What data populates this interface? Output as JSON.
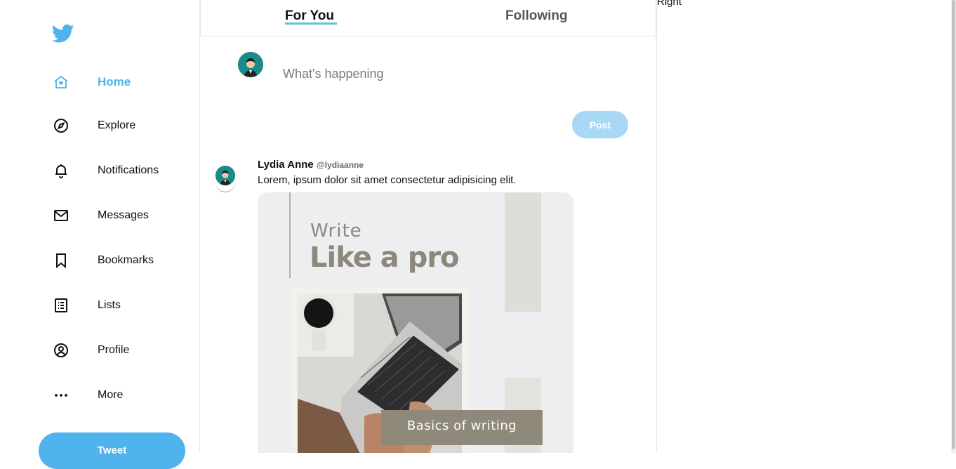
{
  "colors": {
    "brand": "#4fb3ee",
    "active_nav": "#4fb3e8",
    "tab_underline": "#5ec6d6",
    "post_button": "#a8d8f4"
  },
  "sidebar": {
    "logo_icon": "twitter-bird-icon",
    "items": [
      {
        "label": "Home",
        "icon": "home-icon",
        "active": true
      },
      {
        "label": "Explore",
        "icon": "compass-icon"
      },
      {
        "label": "Notifications",
        "icon": "bell-icon"
      },
      {
        "label": "Messages",
        "icon": "envelope-icon"
      },
      {
        "label": "Bookmarks",
        "icon": "bookmark-icon"
      },
      {
        "label": "Lists",
        "icon": "list-icon"
      },
      {
        "label": "Profile",
        "icon": "user-circle-icon"
      },
      {
        "label": "More",
        "icon": "more-dots-icon"
      }
    ],
    "tweet_button": "Tweet"
  },
  "main": {
    "tabs": [
      {
        "label": "For You",
        "active": true
      },
      {
        "label": "Following"
      }
    ],
    "compose": {
      "placeholder": "What's happening",
      "post_button": "Post"
    },
    "tweet": {
      "name": "Lydia Anne",
      "handle": "@lydiaanne",
      "text": "Lorem, ipsum dolor sit amet consectetur adipisicing elit.",
      "image": {
        "line1": "Write",
        "line2": "Like a pro",
        "caption": "Basics of writing"
      }
    }
  },
  "right": {
    "label": "Right"
  }
}
